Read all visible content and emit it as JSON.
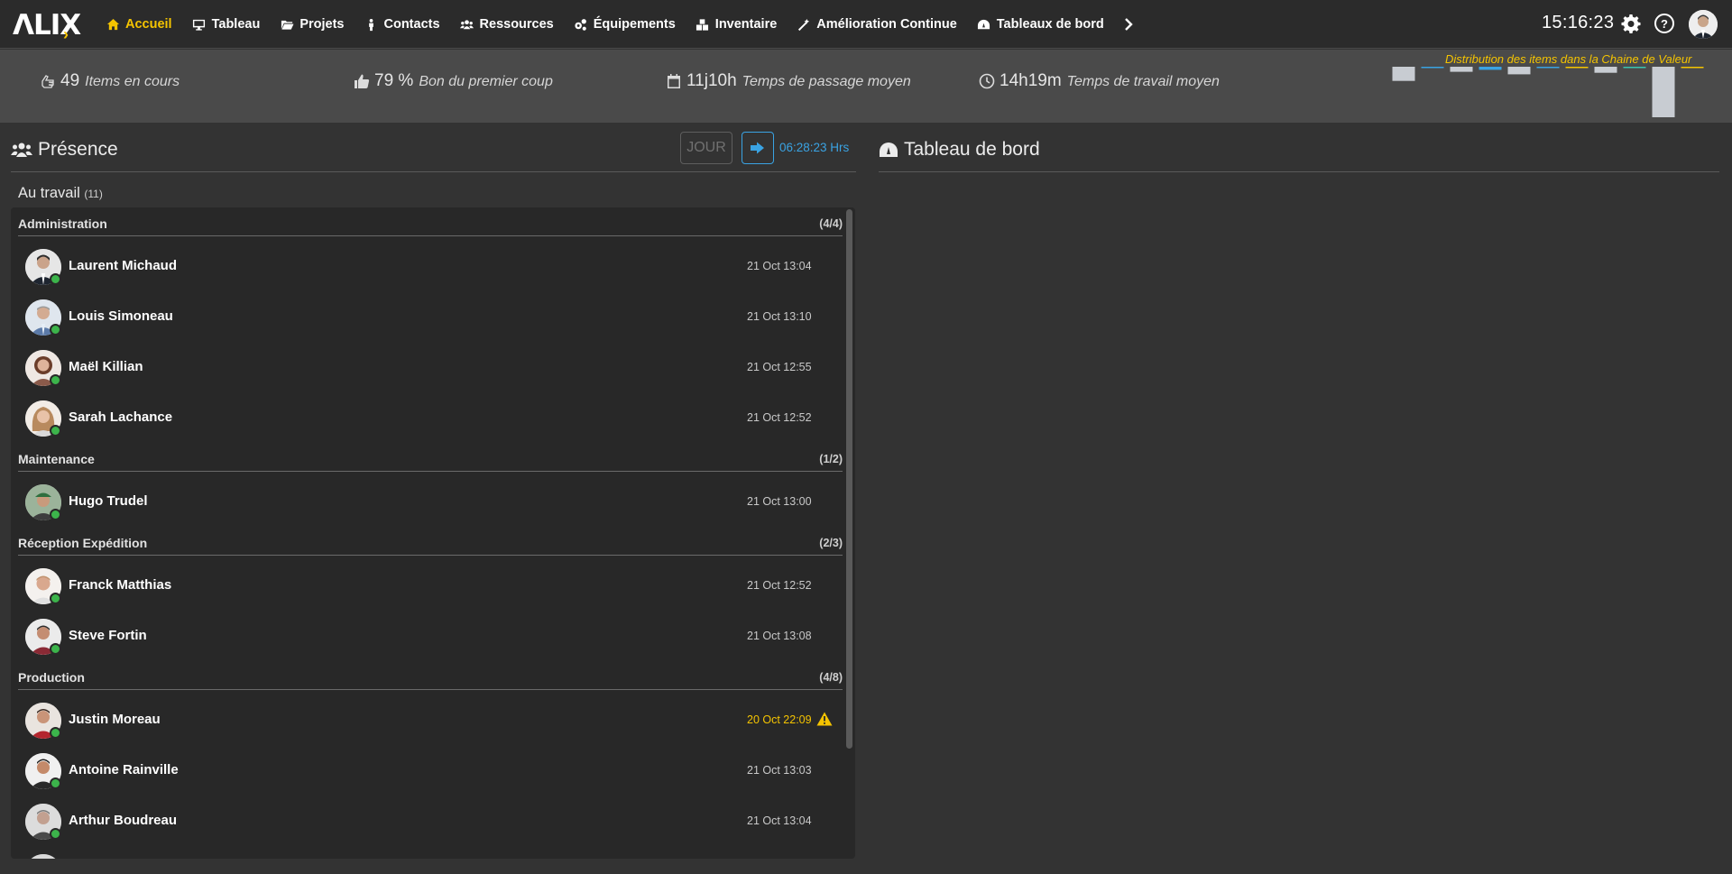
{
  "app": {
    "logo_text": "ΛLIX"
  },
  "nav": {
    "items": [
      {
        "label": "Accueil",
        "icon": "home-icon",
        "active": true
      },
      {
        "label": "Tableau",
        "icon": "monitor-icon"
      },
      {
        "label": "Projets",
        "icon": "folder-icon"
      },
      {
        "label": "Contacts",
        "icon": "person-icon"
      },
      {
        "label": "Ressources",
        "icon": "users-icon"
      },
      {
        "label": "Équipements",
        "icon": "cogs-icon"
      },
      {
        "label": "Inventaire",
        "icon": "boxes-icon"
      },
      {
        "label": "Amélioration Continue",
        "icon": "magic-wand-icon"
      },
      {
        "label": "Tableaux de bord",
        "icon": "dashboard-icon"
      }
    ],
    "more_icon": "chevron-right-icon"
  },
  "header": {
    "clock": "15:16:23",
    "help_label": "?"
  },
  "kpis": {
    "items_in_progress": {
      "value": "49",
      "label": "Items en cours",
      "icon": "hand-icon"
    },
    "first_time_right": {
      "value": "79 %",
      "label": "Bon du premier coup",
      "icon": "thumbs-up-icon"
    },
    "lead_time": {
      "value": "11j10h",
      "label": "Temps de passage moyen",
      "icon": "calendar-icon"
    },
    "work_time": {
      "value": "14h19m",
      "label": "Temps de travail moyen",
      "icon": "clock-icon"
    }
  },
  "distribution": {
    "title": "Distribution des items dans la Chaine de Valeur",
    "bars": [
      {
        "level": 0.28,
        "color": "#c8ccd2"
      },
      {
        "level": 0.0,
        "color": "#3aa3e3"
      },
      {
        "level": 0.1,
        "color": "#c8ccd2"
      },
      {
        "level": 0.06,
        "color": "#3aa3e3"
      },
      {
        "level": 0.15,
        "color": "#c8ccd2"
      },
      {
        "level": 0.0,
        "color": "#3aa3e3"
      },
      {
        "level": 0.0,
        "color": "#f5c400"
      },
      {
        "level": 0.12,
        "color": "#c8ccd2"
      },
      {
        "level": 0.0,
        "color": "#3ac4b0"
      },
      {
        "level": 1.0,
        "color": "#c8ccd2"
      },
      {
        "level": 0.0,
        "color": "#f5c400"
      }
    ]
  },
  "presence": {
    "title": "Présence",
    "day_button": "JOUR",
    "timer": "06:28:23 Hrs",
    "at_work_label": "Au travail",
    "at_work_count": "(11)",
    "groups": [
      {
        "name": "Administration",
        "count": "(4/4)",
        "people": [
          {
            "name": "Laurent Michaud",
            "time": "21 Oct 13:04"
          },
          {
            "name": "Louis Simoneau",
            "time": "21 Oct 13:10"
          },
          {
            "name": "Maël Killian",
            "time": "21 Oct 12:55"
          },
          {
            "name": "Sarah Lachance",
            "time": "21 Oct 12:52"
          }
        ]
      },
      {
        "name": "Maintenance",
        "count": "(1/2)",
        "people": [
          {
            "name": "Hugo Trudel",
            "time": "21 Oct 13:00"
          }
        ]
      },
      {
        "name": "Réception Expédition",
        "count": "(2/3)",
        "people": [
          {
            "name": "Franck Matthias",
            "time": "21 Oct 12:52"
          },
          {
            "name": "Steve Fortin",
            "time": "21 Oct 13:08"
          }
        ]
      },
      {
        "name": "Production",
        "count": "(4/8)",
        "people": [
          {
            "name": "Justin Moreau",
            "time": "20 Oct 22:09",
            "warning": true
          },
          {
            "name": "Antoine Rainville",
            "time": "21 Oct 13:03"
          },
          {
            "name": "Arthur Boudreau",
            "time": "21 Oct 13:04"
          }
        ]
      }
    ]
  },
  "dashboard": {
    "title": "Tableau de bord"
  }
}
